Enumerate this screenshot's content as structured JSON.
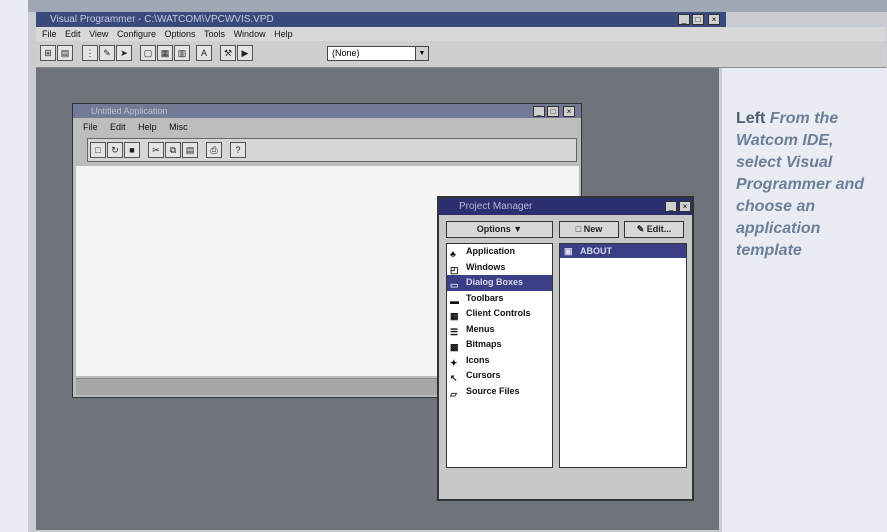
{
  "ide": {
    "title": "Visual Programmer - C:\\WATCOM\\VPCWVIS.VPD",
    "menu": [
      "File",
      "Edit",
      "View",
      "Configure",
      "Options",
      "Tools",
      "Window",
      "Help"
    ],
    "toolbar_combo_value": "(None)",
    "window_controls": [
      "_",
      "□",
      "×"
    ]
  },
  "child_window": {
    "title": "Untitled Application",
    "menu": [
      "File",
      "Edit",
      "Help",
      "Misc"
    ],
    "window_controls": [
      "_",
      "□",
      "×"
    ]
  },
  "project_manager": {
    "title": "Project Manager",
    "options_button": "Options",
    "new_button": "New",
    "edit_button": "Edit...",
    "categories": [
      "Application",
      "Windows",
      "Dialog Boxes",
      "Toolbars",
      "Client Controls",
      "Menus",
      "Bitmaps",
      "Icons",
      "Cursors",
      "Source Files"
    ],
    "selected_category": "Dialog Boxes",
    "items": [
      "ABOUT"
    ]
  },
  "caption": {
    "lead": "Left",
    "text": "From the Watcom IDE, select Visual Programmer and choose an application template"
  }
}
